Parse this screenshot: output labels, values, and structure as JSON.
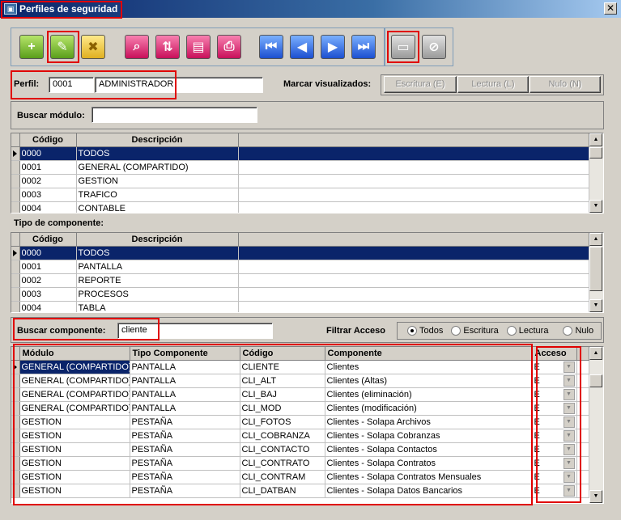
{
  "window": {
    "title": "Perfiles de seguridad",
    "close": "✕"
  },
  "toolbar": {
    "buttons": [
      {
        "name": "add-button",
        "glyph": "+"
      },
      {
        "name": "edit-button",
        "glyph": "✎"
      },
      {
        "name": "delete-button",
        "glyph": "✖"
      },
      {
        "name": "search-button",
        "glyph": "⌕"
      },
      {
        "name": "sort-button",
        "glyph": "⇅"
      },
      {
        "name": "clipboard-button",
        "glyph": "▤"
      },
      {
        "name": "print-button",
        "glyph": "⎙"
      },
      {
        "name": "first-record-button",
        "glyph": "⏮"
      },
      {
        "name": "prev-record-button",
        "glyph": "◀"
      },
      {
        "name": "next-record-button",
        "glyph": "▶"
      },
      {
        "name": "last-record-button",
        "glyph": "⏭"
      },
      {
        "name": "save-button",
        "glyph": "▭"
      },
      {
        "name": "cancel-button",
        "glyph": "⊘"
      }
    ]
  },
  "perfil": {
    "label": "Perfil:",
    "code": "0001",
    "name": "ADMINISTRADOR",
    "marcar_label": "Marcar visualizados:",
    "btn_escritura": "Escritura (E)",
    "btn_lectura": "Lectura (L)",
    "btn_nulo": "Nulo (N)"
  },
  "buscar_modulo": {
    "label": "Buscar módulo:",
    "value": ""
  },
  "modulos": {
    "headers": [
      "Código",
      "Descripción"
    ],
    "rows": [
      [
        "0000",
        "TODOS"
      ],
      [
        "0001",
        "GENERAL (COMPARTIDO)"
      ],
      [
        "0002",
        "GESTION"
      ],
      [
        "0003",
        "TRAFICO"
      ],
      [
        "0004",
        "CONTABLE"
      ]
    ]
  },
  "tipo_componente": {
    "label": "Tipo de componente:",
    "headers": [
      "Código",
      "Descripción"
    ],
    "rows": [
      [
        "0000",
        "TODOS"
      ],
      [
        "0001",
        "PANTALLA"
      ],
      [
        "0002",
        "REPORTE"
      ],
      [
        "0003",
        "PROCESOS"
      ],
      [
        "0004",
        "TABLA"
      ]
    ]
  },
  "buscar_componente": {
    "label": "Buscar componente:",
    "value": "cliente"
  },
  "filtrar": {
    "label": "Filtrar Acceso",
    "options": [
      "Todos",
      "Escritura",
      "Lectura",
      "Nulo"
    ],
    "selected": "Todos"
  },
  "componentes": {
    "headers": [
      "Módulo",
      "Tipo Componente",
      "Código",
      "Componente",
      "Acceso"
    ],
    "rows": [
      [
        "GENERAL (COMPARTIDO)",
        "PANTALLA",
        "CLIENTE",
        "Clientes",
        "E"
      ],
      [
        "GENERAL (COMPARTIDO)",
        "PANTALLA",
        "CLI_ALT",
        "Clientes (Altas)",
        "E"
      ],
      [
        "GENERAL (COMPARTIDO)",
        "PANTALLA",
        "CLI_BAJ",
        "Clientes (eliminación)",
        "E"
      ],
      [
        "GENERAL (COMPARTIDO)",
        "PANTALLA",
        "CLI_MOD",
        "Clientes (modificación)",
        "E"
      ],
      [
        "GESTION",
        "PESTAÑA",
        "CLI_FOTOS",
        "Clientes - Solapa Archivos",
        "E"
      ],
      [
        "GESTION",
        "PESTAÑA",
        "CLI_COBRANZA",
        "Clientes - Solapa Cobranzas",
        "E"
      ],
      [
        "GESTION",
        "PESTAÑA",
        "CLI_CONTACTO",
        "Clientes - Solapa Contactos",
        "E"
      ],
      [
        "GESTION",
        "PESTAÑA",
        "CLI_CONTRATO",
        "Clientes - Solapa Contratos",
        "E"
      ],
      [
        "GESTION",
        "PESTAÑA",
        "CLI_CONTRAM",
        "Clientes - Solapa Contratos Mensuales",
        "E"
      ],
      [
        "GESTION",
        "PESTAÑA",
        "CLI_DATBAN",
        "Clientes - Solapa Datos Bancarios",
        "E"
      ]
    ]
  }
}
